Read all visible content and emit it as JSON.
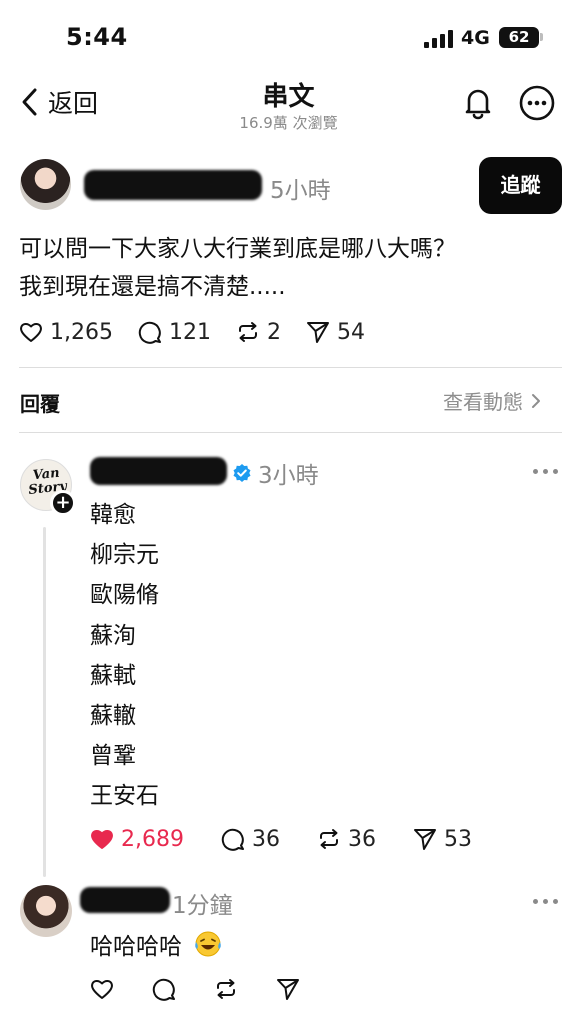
{
  "status_bar": {
    "time": "5:44",
    "network": "4G",
    "battery": "62"
  },
  "nav": {
    "back_label": "返回",
    "title": "串文",
    "subtitle": "16.9萬 次瀏覽"
  },
  "post": {
    "time": "5小時",
    "follow_label": "追蹤",
    "lines": [
      "可以問一下大家八大行業到底是哪八大嗎？",
      "我到現在還是搞不清楚....."
    ],
    "likes": "1,265",
    "comments": "121",
    "reposts": "2",
    "shares": "54"
  },
  "replies_header": {
    "label": "回覆",
    "activity_label": "查看動態"
  },
  "reply1": {
    "avatar_text": "Van Story",
    "time": "3小時",
    "lines": [
      "韓愈",
      "柳宗元",
      "歐陽脩",
      "蘇洵",
      "蘇軾",
      "蘇轍",
      "曾鞏",
      "王安石"
    ],
    "likes": "2,689",
    "comments": "36",
    "reposts": "36",
    "shares": "53",
    "liked": true
  },
  "reply2": {
    "time": "1分鐘",
    "text": "哈哈哈哈"
  },
  "colors": {
    "like_red": "#e8294e",
    "verified_blue": "#1d9bf0",
    "text_muted": "#8a8a8a"
  },
  "icons": [
    "chevron-left-icon",
    "bell-icon",
    "more-icon",
    "heart-icon",
    "comment-icon",
    "repost-icon",
    "share-icon",
    "verified-icon",
    "plus-icon",
    "chevron-right-icon",
    "laughing-emoji-icon"
  ]
}
